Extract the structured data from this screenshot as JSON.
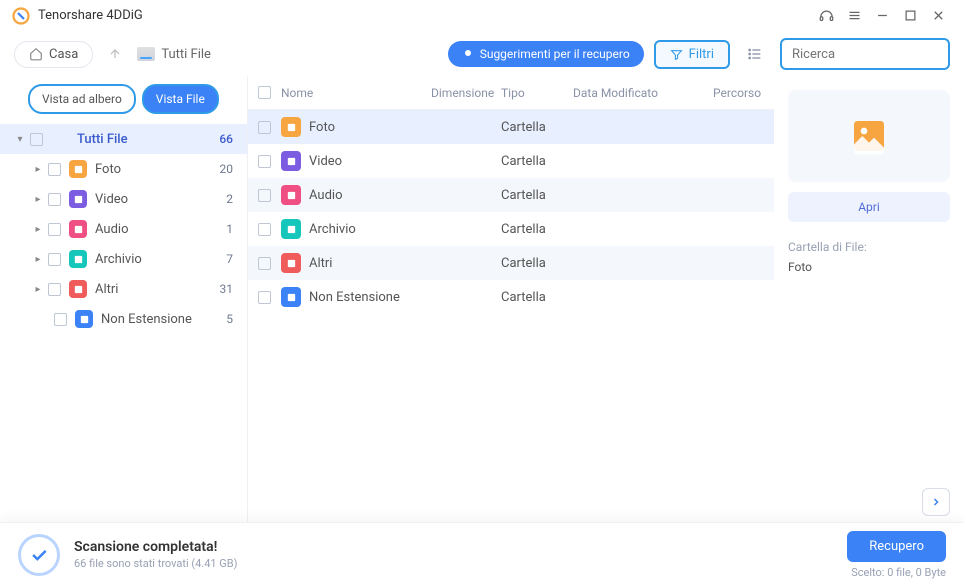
{
  "app_title": "Tenorshare 4DDiG",
  "toolbar": {
    "home": "Casa",
    "breadcrumb": "Tutti File",
    "tips": "Suggerimenti per il recupero",
    "filter": "Filtri",
    "search_placeholder": "Ricerca"
  },
  "tabs": {
    "tree": "Vista ad albero",
    "file": "Vista File"
  },
  "tree": {
    "root": {
      "label": "Tutti File",
      "count": "66"
    },
    "items": [
      {
        "label": "Foto",
        "count": "20",
        "color": "ic-orange"
      },
      {
        "label": "Video",
        "count": "2",
        "color": "ic-purple"
      },
      {
        "label": "Audio",
        "count": "1",
        "color": "ic-pink"
      },
      {
        "label": "Archivio",
        "count": "7",
        "color": "ic-teal"
      },
      {
        "label": "Altri",
        "count": "31",
        "color": "ic-red"
      },
      {
        "label": "Non Estensione",
        "count": "5",
        "color": "ic-blue"
      }
    ]
  },
  "table": {
    "headers": {
      "name": "Nome",
      "size": "Dimensione",
      "type": "Tipo",
      "date": "Data Modificato",
      "path": "Percorso"
    },
    "rows": [
      {
        "name": "Foto",
        "type": "Cartella",
        "color": "ic-orange",
        "selected": true
      },
      {
        "name": "Video",
        "type": "Cartella",
        "color": "ic-purple",
        "selected": false
      },
      {
        "name": "Audio",
        "type": "Cartella",
        "color": "ic-pink",
        "selected": false
      },
      {
        "name": "Archivio",
        "type": "Cartella",
        "color": "ic-teal",
        "selected": false
      },
      {
        "name": "Altri",
        "type": "Cartella",
        "color": "ic-red",
        "selected": false
      },
      {
        "name": "Non Estensione",
        "type": "Cartella",
        "color": "ic-blue",
        "selected": false
      }
    ]
  },
  "preview": {
    "open": "Apri",
    "folder_label": "Cartella di File:",
    "folder_value": "Foto"
  },
  "footer": {
    "title": "Scansione completata!",
    "subtitle": "66 file sono stati trovati (4.41 GB)",
    "recover": "Recupero",
    "status": "Scelto: 0 file, 0 Byte"
  }
}
